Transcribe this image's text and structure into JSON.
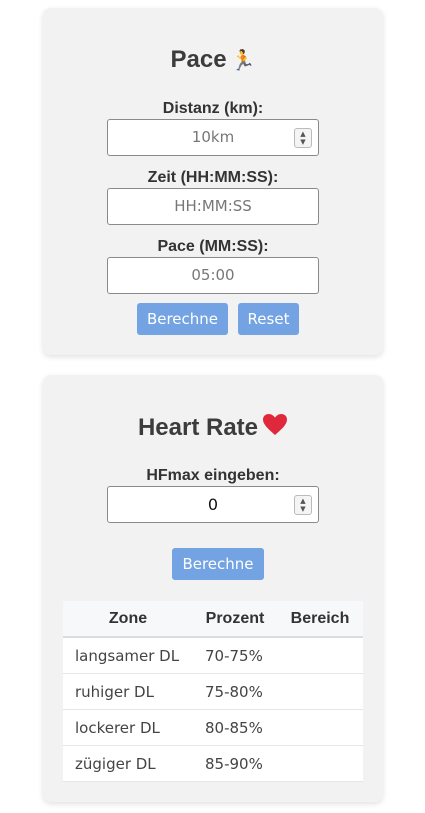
{
  "pace": {
    "title": "Pace",
    "title_icon": "runner-icon",
    "distance_label": "Distanz (km):",
    "distance_placeholder": "10km",
    "time_label": "Zeit (HH:MM:SS):",
    "time_placeholder": "HH:MM:SS",
    "pace_label": "Pace (MM:SS):",
    "pace_placeholder": "05:00",
    "calc_button": "Berechne",
    "reset_button": "Reset"
  },
  "heart_rate": {
    "title": "Heart Rate",
    "title_icon": "heart-icon",
    "hfmax_label": "HFmax eingeben:",
    "hfmax_value": "0",
    "calc_button": "Berechne",
    "table": {
      "headers": [
        "Zone",
        "Prozent",
        "Bereich"
      ],
      "rows": [
        {
          "zone": "langsamer DL",
          "percent": "70-75%",
          "range": ""
        },
        {
          "zone": "ruhiger DL",
          "percent": "75-80%",
          "range": ""
        },
        {
          "zone": "lockerer DL",
          "percent": "80-85%",
          "range": ""
        },
        {
          "zone": "zügiger DL",
          "percent": "85-90%",
          "range": ""
        }
      ]
    }
  },
  "colors": {
    "button": "#73a3e3",
    "card": "#f2f2f2",
    "heart": "#e0283c"
  }
}
